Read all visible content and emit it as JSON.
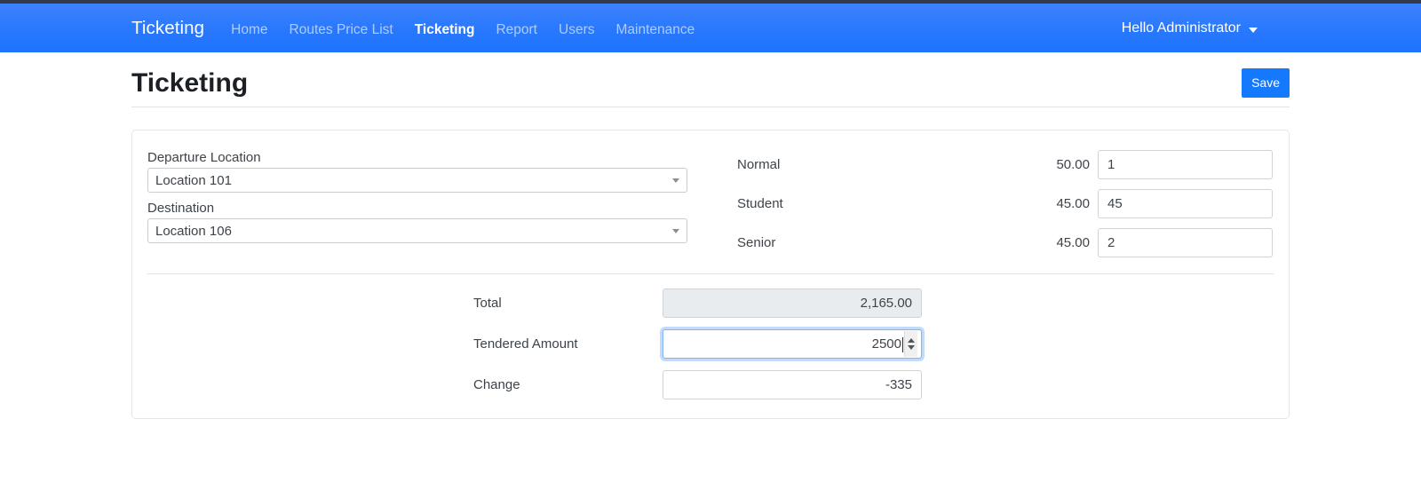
{
  "navbar": {
    "brand": "Ticketing",
    "links": [
      {
        "label": "Home",
        "active": false
      },
      {
        "label": "Routes Price List",
        "active": false
      },
      {
        "label": "Ticketing",
        "active": true
      },
      {
        "label": "Report",
        "active": false
      },
      {
        "label": "Users",
        "active": false
      },
      {
        "label": "Maintenance",
        "active": false
      }
    ],
    "user_greeting": "Hello Administrator",
    "accent_color": "#2878fd"
  },
  "header": {
    "title": "Ticketing",
    "save_label": "Save",
    "save_color": "#1479fd"
  },
  "form": {
    "departure": {
      "label": "Departure Location",
      "value": "Location 101"
    },
    "destination": {
      "label": "Destination",
      "value": "Location 106"
    },
    "fares": [
      {
        "name": "Normal",
        "price": "50.00",
        "qty": "1"
      },
      {
        "name": "Student",
        "price": "45.00",
        "qty": "45"
      },
      {
        "name": "Senior",
        "price": "45.00",
        "qty": "2"
      }
    ],
    "totals": [
      {
        "label": "Total",
        "value": "2,165.00"
      },
      {
        "label": "Tendered Amount",
        "value": "2500"
      },
      {
        "label": "Change",
        "value": "-335"
      }
    ]
  }
}
